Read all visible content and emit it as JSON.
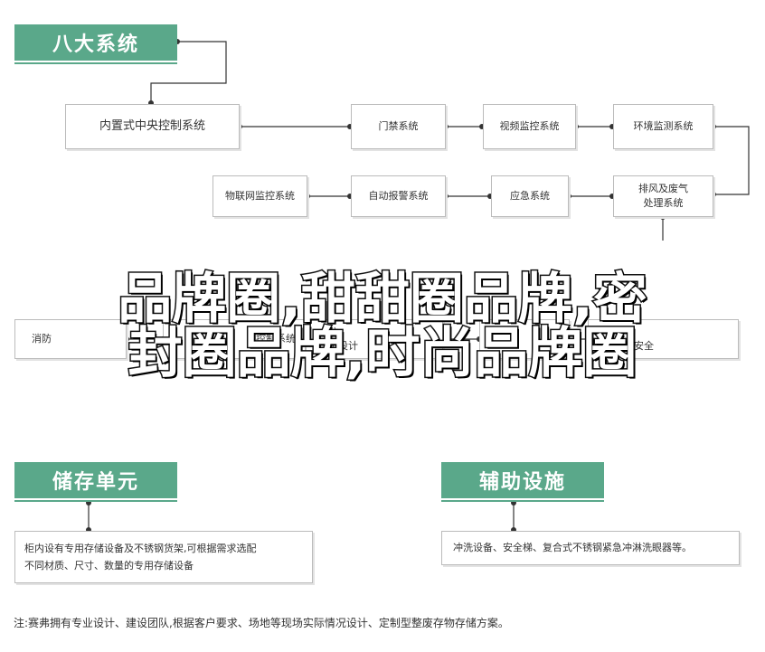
{
  "colors": {
    "accent": "#5aa88a",
    "line": "#333333",
    "box_border": "#bbbbbb"
  },
  "section_eight": {
    "title": "八大系统",
    "central": "内置式中央控制系统",
    "row1": [
      "门禁系统",
      "视频监控系统",
      "环境监测系统"
    ],
    "row2": [
      "物联网监控系统",
      "自动报警系统",
      "应急系统",
      "排风及废气\n处理系统"
    ],
    "row3": [
      "消防",
      "控制系统",
      "防",
      "电设计",
      "安",
      "防护安全"
    ]
  },
  "overlay_text": {
    "line1": "品牌圈,甜甜圈品牌,密",
    "line2": "封圈品牌,时尚品牌圈"
  },
  "storage": {
    "title": "储存单元",
    "desc": "柜内设有专用存储设备及不锈钢货架,可根据需求选配\n不同材质、尺寸、数量的专用存储设备"
  },
  "aux": {
    "title": "辅助设施",
    "desc": "冲洗设备、安全梯、复合式不锈钢紧急冲淋洗眼器等。"
  },
  "footnote": "注:赛弗拥有专业设计、建设团队,根据客户要求、场地等现场实际情况设计、定制型整废存物存储方案。"
}
